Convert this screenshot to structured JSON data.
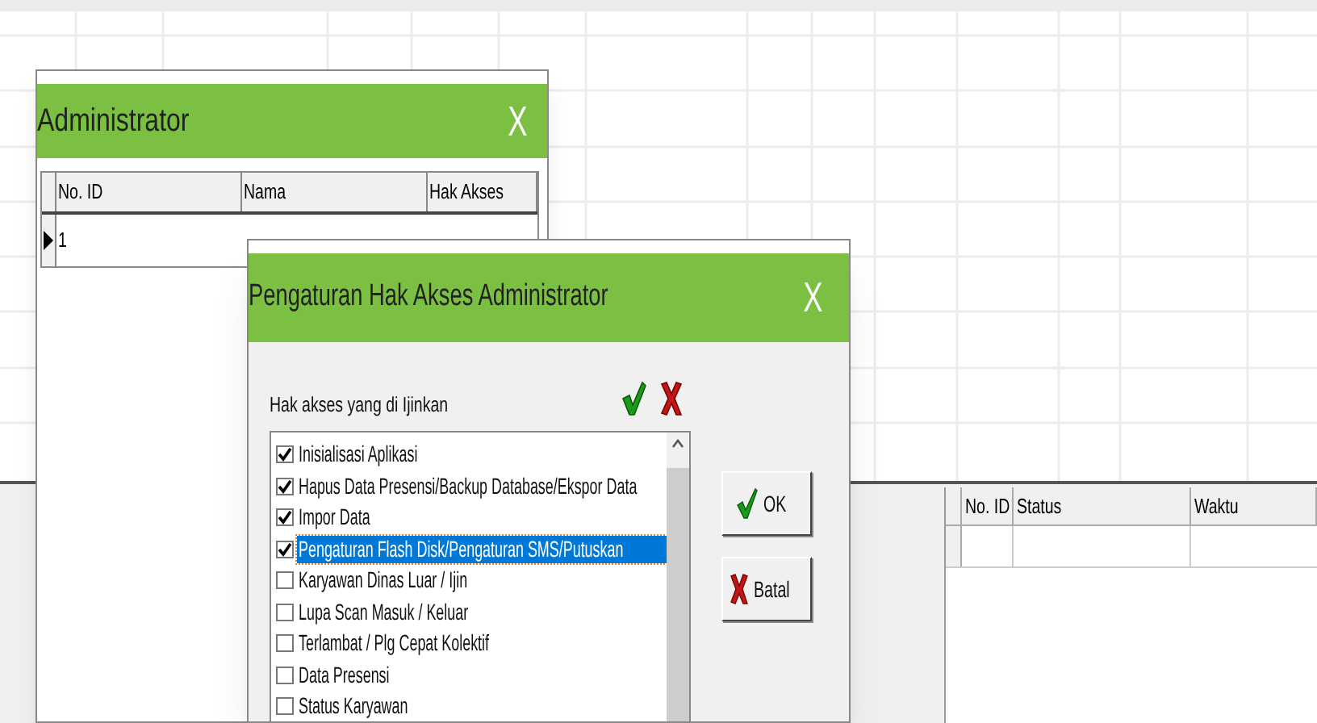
{
  "admin_window": {
    "title": "Administrator",
    "close": "X",
    "table": {
      "columns": [
        "No. ID",
        "Nama",
        "Hak Akses"
      ],
      "rows": [
        {
          "no_id": "1",
          "selected": true
        }
      ]
    }
  },
  "log_table": {
    "columns": [
      "No. ID",
      "Status",
      "Waktu"
    ]
  },
  "dialog": {
    "title": "Pengaturan Hak Akses Administrator",
    "close": "X",
    "label": "Hak akses yang di Ijinkan",
    "items": [
      {
        "label": "Inisialisasi Aplikasi",
        "checked": true,
        "selected": false
      },
      {
        "label": "Hapus Data Presensi/Backup Database/Ekspor Data",
        "checked": true,
        "selected": false
      },
      {
        "label": "Impor Data",
        "checked": true,
        "selected": false
      },
      {
        "label": "Pengaturan Flash Disk/Pengaturan SMS/Putuskan",
        "checked": true,
        "selected": true
      },
      {
        "label": "Karyawan Dinas Luar / Ijin",
        "checked": false,
        "selected": false
      },
      {
        "label": "Lupa Scan Masuk / Keluar",
        "checked": false,
        "selected": false
      },
      {
        "label": "Terlambat / Plg Cepat Kolektif",
        "checked": false,
        "selected": false
      },
      {
        "label": "Data Presensi",
        "checked": false,
        "selected": false
      },
      {
        "label": "Status Karyawan",
        "checked": false,
        "selected": false
      }
    ],
    "buttons": [
      {
        "label": "OK",
        "kind": "ok"
      },
      {
        "label": "Batal",
        "kind": "cancel"
      }
    ]
  }
}
